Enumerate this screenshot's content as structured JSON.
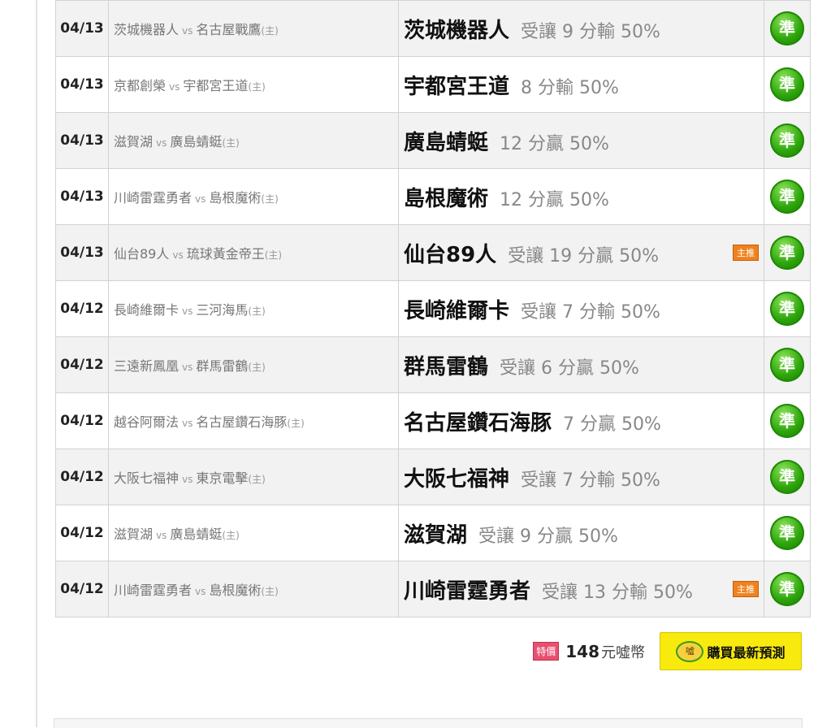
{
  "picks": [
    {
      "date": "04/13",
      "away": "茨城機器人",
      "home": "名古屋戰鷹",
      "pick_team": "茨城機器人",
      "line": "受讓 9 分輸 50%",
      "tag": "",
      "badge": "準"
    },
    {
      "date": "04/13",
      "away": "京都創榮",
      "home": "宇都宮王道",
      "pick_team": "宇都宮王道",
      "line": "8 分輸 50%",
      "tag": "",
      "badge": "準"
    },
    {
      "date": "04/13",
      "away": "滋賀湖",
      "home": "廣島蜻蜓",
      "pick_team": "廣島蜻蜓",
      "line": "12 分贏 50%",
      "tag": "",
      "badge": "準"
    },
    {
      "date": "04/13",
      "away": "川崎雷霆勇者",
      "home": "島根魔術",
      "pick_team": "島根魔術",
      "line": "12 分贏 50%",
      "tag": "",
      "badge": "準"
    },
    {
      "date": "04/13",
      "away": "仙台89人",
      "home": "琉球黃金帝王",
      "pick_team": "仙台89人",
      "line": "受讓 19 分贏 50%",
      "tag": "主推",
      "badge": "準"
    },
    {
      "date": "04/12",
      "away": "長崎維爾卡",
      "home": "三河海馬",
      "pick_team": "長崎維爾卡",
      "line": "受讓 7 分輸 50%",
      "tag": "",
      "badge": "準"
    },
    {
      "date": "04/12",
      "away": "三遠新鳳凰",
      "home": "群馬雷鶴",
      "pick_team": "群馬雷鶴",
      "line": "受讓 6 分贏 50%",
      "tag": "",
      "badge": "準"
    },
    {
      "date": "04/12",
      "away": "越谷阿爾法",
      "home": "名古屋鑽石海豚",
      "pick_team": "名古屋鑽石海豚",
      "line": "7 分贏 50%",
      "tag": "",
      "badge": "準"
    },
    {
      "date": "04/12",
      "away": "大阪七福神",
      "home": "東京電擊",
      "pick_team": "大阪七福神",
      "line": "受讓 7 分輸 50%",
      "tag": "",
      "badge": "準"
    },
    {
      "date": "04/12",
      "away": "滋賀湖",
      "home": "廣島蜻蜓",
      "pick_team": "滋賀湖",
      "line": "受讓 9 分贏 50%",
      "tag": "",
      "badge": "準"
    },
    {
      "date": "04/12",
      "away": "川崎雷霆勇者",
      "home": "島根魔術",
      "pick_team": "川崎雷霆勇者",
      "line": "受讓 13 分輸 50%",
      "tag": "主推",
      "badge": "準"
    }
  ],
  "vs_label": "vs",
  "host_label": "(主)",
  "purchase": {
    "special_tag": "特價",
    "price": "148",
    "unit": "元噓幣",
    "coin_label": "噓",
    "button_label": "購買最新預測"
  }
}
